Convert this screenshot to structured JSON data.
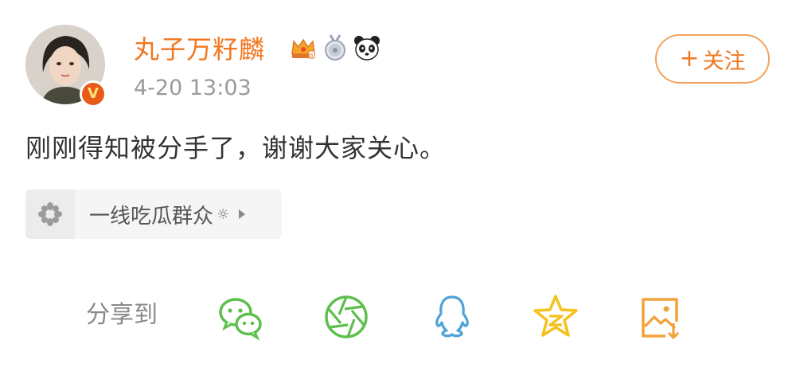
{
  "user": {
    "name": "丸子万籽麟",
    "verified_icon": "v-verified-icon",
    "badges": [
      "crown-vip-icon",
      "medal-icon",
      "panda-icon"
    ]
  },
  "post": {
    "timestamp": "4-20 13:03",
    "text": "刚刚得知被分手了，谢谢大家关心。"
  },
  "follow_button": {
    "plus": "+",
    "label": "关注"
  },
  "topic_tag": {
    "label": "一线吃瓜群众",
    "suffix": "☼"
  },
  "share": {
    "label": "分享到",
    "targets": [
      "wechat-icon",
      "moments-icon",
      "qq-icon",
      "qzone-icon",
      "save-image-icon"
    ]
  },
  "colors": {
    "accent": "#f2771f",
    "wechat": "#5dbf4c",
    "moments": "#5dbf4c",
    "qq": "#4fa3d6",
    "qzone": "#f5c11b",
    "save": "#f2a23a"
  }
}
